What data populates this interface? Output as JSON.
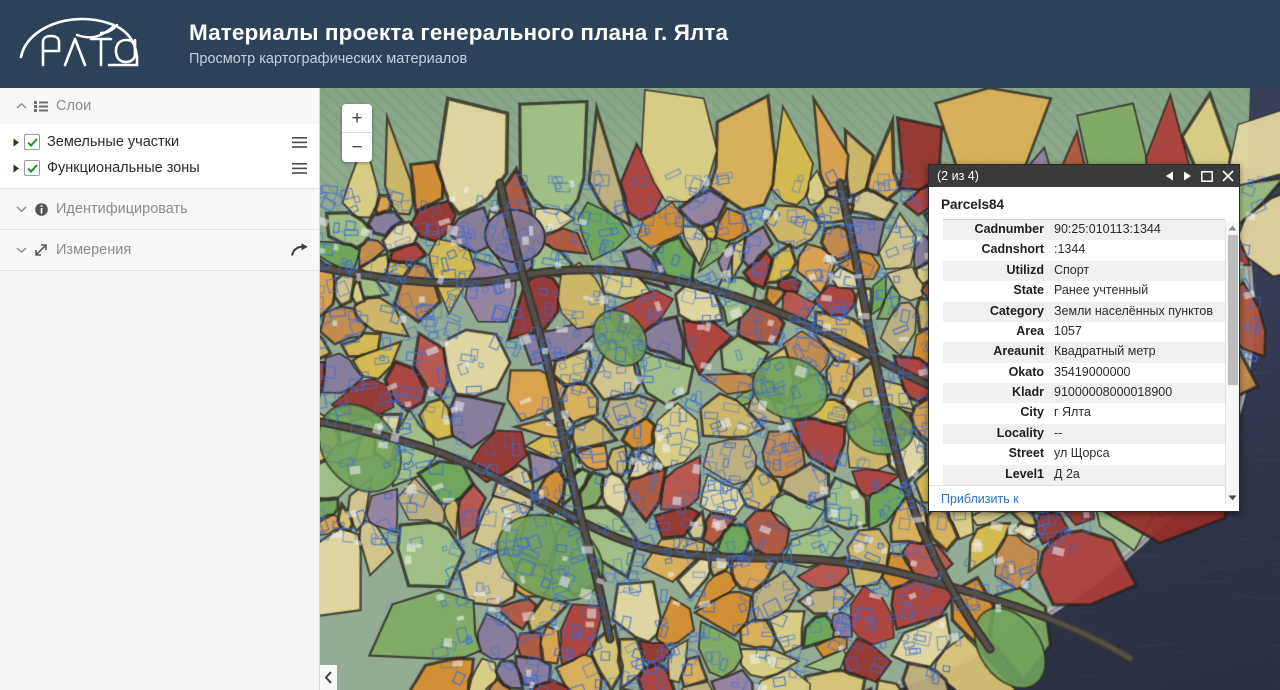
{
  "header": {
    "logo_text": "ЯЛТА",
    "logo_icon": "yalta-arc-seagull-logo",
    "title": "Материалы проекта генерального плана г. Ялта",
    "subtitle": "Просмотр картографических материалов",
    "background_color": "#2d4158"
  },
  "sidebar": {
    "panels": [
      {
        "id": "layers",
        "label": "Слои",
        "icon": "list-icon",
        "chevron": "chevron-up-icon",
        "expanded": true,
        "layers": [
          {
            "label": "Земельные участки",
            "checked": true,
            "expander": "triangle-right-icon",
            "menu_icon": "hamburger-menu-icon"
          },
          {
            "label": "Функциональные зоны",
            "checked": true,
            "expander": "triangle-right-icon",
            "menu_icon": "hamburger-menu-icon"
          }
        ]
      },
      {
        "id": "identify",
        "label": "Идентифицировать",
        "icon": "info-circle-icon",
        "chevron": "chevron-down-icon",
        "expanded": false
      },
      {
        "id": "measure",
        "label": "Измерения",
        "icon": "measure-diagonal-arrows-icon",
        "chevron": "chevron-down-icon",
        "expanded": false,
        "right_icon": "share-arrow-icon"
      }
    ],
    "checkbox_check_color": "#1d8f30"
  },
  "map": {
    "zoom_in_label": "+",
    "zoom_out_label": "−",
    "collapse_icon": "chevron-left-icon",
    "sea_color": "#2e3349",
    "forest_color": "#8fae8e"
  },
  "popup": {
    "count_label": "(2 из 4)",
    "controls": {
      "prev": "prev-triangle-icon",
      "next": "next-triangle-icon",
      "maximize": "maximize-square-icon",
      "close": "close-x-icon"
    },
    "feature_name": "Parcels84",
    "attributes": [
      {
        "key": "Cadnumber",
        "value": "90:25:010113:1344"
      },
      {
        "key": "Cadnshort",
        "value": ":1344"
      },
      {
        "key": "Utilizd",
        "value": "Спорт"
      },
      {
        "key": "State",
        "value": "Ранее учтенный"
      },
      {
        "key": "Category",
        "value": "Земли населённых пунктов"
      },
      {
        "key": "Area",
        "value": "1057"
      },
      {
        "key": "Areaunit",
        "value": "Квадратный метр"
      },
      {
        "key": "Okato",
        "value": "35419000000"
      },
      {
        "key": "Kladr",
        "value": "91000008000018900"
      },
      {
        "key": "City",
        "value": "г Ялта"
      },
      {
        "key": "Locality",
        "value": "--"
      },
      {
        "key": "Street",
        "value": "ул Щорса"
      },
      {
        "key": "Level1",
        "value": "Д 2а"
      }
    ],
    "footer_link": "Приблизить к",
    "scrollbar": {
      "up": "scroll-up-arrow-icon",
      "down": "scroll-down-arrow-icon"
    }
  }
}
